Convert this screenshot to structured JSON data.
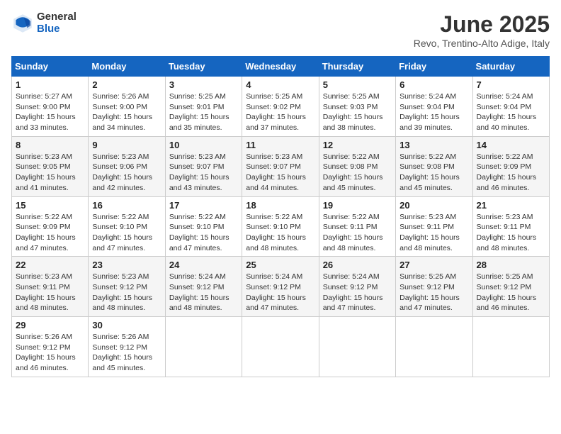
{
  "logo": {
    "general": "General",
    "blue": "Blue"
  },
  "title": "June 2025",
  "subtitle": "Revo, Trentino-Alto Adige, Italy",
  "weekdays": [
    "Sunday",
    "Monday",
    "Tuesday",
    "Wednesday",
    "Thursday",
    "Friday",
    "Saturday"
  ],
  "weeks": [
    [
      {
        "day": "1",
        "sunrise": "5:27 AM",
        "sunset": "9:00 PM",
        "daylight": "15 hours and 33 minutes."
      },
      {
        "day": "2",
        "sunrise": "5:26 AM",
        "sunset": "9:00 PM",
        "daylight": "15 hours and 34 minutes."
      },
      {
        "day": "3",
        "sunrise": "5:25 AM",
        "sunset": "9:01 PM",
        "daylight": "15 hours and 35 minutes."
      },
      {
        "day": "4",
        "sunrise": "5:25 AM",
        "sunset": "9:02 PM",
        "daylight": "15 hours and 37 minutes."
      },
      {
        "day": "5",
        "sunrise": "5:25 AM",
        "sunset": "9:03 PM",
        "daylight": "15 hours and 38 minutes."
      },
      {
        "day": "6",
        "sunrise": "5:24 AM",
        "sunset": "9:04 PM",
        "daylight": "15 hours and 39 minutes."
      },
      {
        "day": "7",
        "sunrise": "5:24 AM",
        "sunset": "9:04 PM",
        "daylight": "15 hours and 40 minutes."
      }
    ],
    [
      {
        "day": "8",
        "sunrise": "5:23 AM",
        "sunset": "9:05 PM",
        "daylight": "15 hours and 41 minutes."
      },
      {
        "day": "9",
        "sunrise": "5:23 AM",
        "sunset": "9:06 PM",
        "daylight": "15 hours and 42 minutes."
      },
      {
        "day": "10",
        "sunrise": "5:23 AM",
        "sunset": "9:07 PM",
        "daylight": "15 hours and 43 minutes."
      },
      {
        "day": "11",
        "sunrise": "5:23 AM",
        "sunset": "9:07 PM",
        "daylight": "15 hours and 44 minutes."
      },
      {
        "day": "12",
        "sunrise": "5:22 AM",
        "sunset": "9:08 PM",
        "daylight": "15 hours and 45 minutes."
      },
      {
        "day": "13",
        "sunrise": "5:22 AM",
        "sunset": "9:08 PM",
        "daylight": "15 hours and 45 minutes."
      },
      {
        "day": "14",
        "sunrise": "5:22 AM",
        "sunset": "9:09 PM",
        "daylight": "15 hours and 46 minutes."
      }
    ],
    [
      {
        "day": "15",
        "sunrise": "5:22 AM",
        "sunset": "9:09 PM",
        "daylight": "15 hours and 47 minutes."
      },
      {
        "day": "16",
        "sunrise": "5:22 AM",
        "sunset": "9:10 PM",
        "daylight": "15 hours and 47 minutes."
      },
      {
        "day": "17",
        "sunrise": "5:22 AM",
        "sunset": "9:10 PM",
        "daylight": "15 hours and 47 minutes."
      },
      {
        "day": "18",
        "sunrise": "5:22 AM",
        "sunset": "9:10 PM",
        "daylight": "15 hours and 48 minutes."
      },
      {
        "day": "19",
        "sunrise": "5:22 AM",
        "sunset": "9:11 PM",
        "daylight": "15 hours and 48 minutes."
      },
      {
        "day": "20",
        "sunrise": "5:23 AM",
        "sunset": "9:11 PM",
        "daylight": "15 hours and 48 minutes."
      },
      {
        "day": "21",
        "sunrise": "5:23 AM",
        "sunset": "9:11 PM",
        "daylight": "15 hours and 48 minutes."
      }
    ],
    [
      {
        "day": "22",
        "sunrise": "5:23 AM",
        "sunset": "9:11 PM",
        "daylight": "15 hours and 48 minutes."
      },
      {
        "day": "23",
        "sunrise": "5:23 AM",
        "sunset": "9:12 PM",
        "daylight": "15 hours and 48 minutes."
      },
      {
        "day": "24",
        "sunrise": "5:24 AM",
        "sunset": "9:12 PM",
        "daylight": "15 hours and 48 minutes."
      },
      {
        "day": "25",
        "sunrise": "5:24 AM",
        "sunset": "9:12 PM",
        "daylight": "15 hours and 47 minutes."
      },
      {
        "day": "26",
        "sunrise": "5:24 AM",
        "sunset": "9:12 PM",
        "daylight": "15 hours and 47 minutes."
      },
      {
        "day": "27",
        "sunrise": "5:25 AM",
        "sunset": "9:12 PM",
        "daylight": "15 hours and 47 minutes."
      },
      {
        "day": "28",
        "sunrise": "5:25 AM",
        "sunset": "9:12 PM",
        "daylight": "15 hours and 46 minutes."
      }
    ],
    [
      {
        "day": "29",
        "sunrise": "5:26 AM",
        "sunset": "9:12 PM",
        "daylight": "15 hours and 46 minutes."
      },
      {
        "day": "30",
        "sunrise": "5:26 AM",
        "sunset": "9:12 PM",
        "daylight": "15 hours and 45 minutes."
      },
      null,
      null,
      null,
      null,
      null
    ]
  ]
}
